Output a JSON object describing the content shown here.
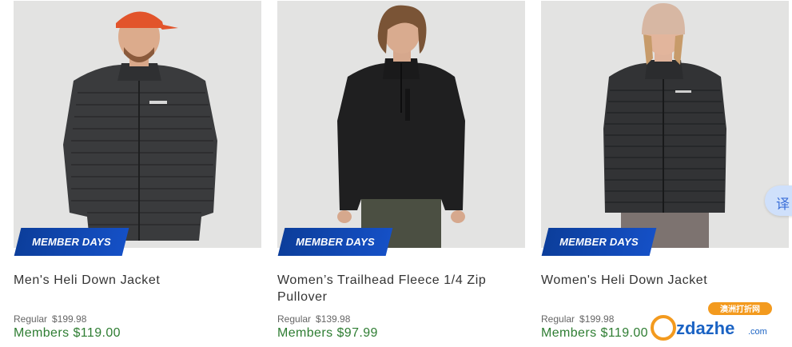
{
  "products": [
    {
      "badge": "MEMBER DAYS",
      "title": "Men's Heli Down Jacket",
      "regular_label": "Regular",
      "regular_price": "$199.98",
      "members_label": "Members",
      "members_price": "$119.00",
      "image": "man-black-down-jacket-orange-cap"
    },
    {
      "badge": "MEMBER DAYS",
      "title": "Women’s Trailhead Fleece 1/4 Zip Pullover",
      "regular_label": "Regular",
      "regular_price": "$139.98",
      "members_label": "Members",
      "members_price": "$97.99",
      "image": "woman-black-fleece-pullover"
    },
    {
      "badge": "MEMBER DAYS",
      "title": "Women's Heli Down Jacket",
      "regular_label": "Regular",
      "regular_price": "$199.98",
      "members_label": "Members",
      "members_price": "$119.00",
      "image": "woman-black-down-jacket-beanie"
    }
  ],
  "translate_button": {
    "label": "译",
    "icon": "translate-icon"
  },
  "watermark": {
    "cn_text": "澳洲打折网",
    "brand": "ozdazhe",
    "suffix": ".com"
  },
  "colors": {
    "badge_blue": "#1550c6",
    "members_green": "#2e7d32",
    "image_bg": "#e3e3e2"
  }
}
